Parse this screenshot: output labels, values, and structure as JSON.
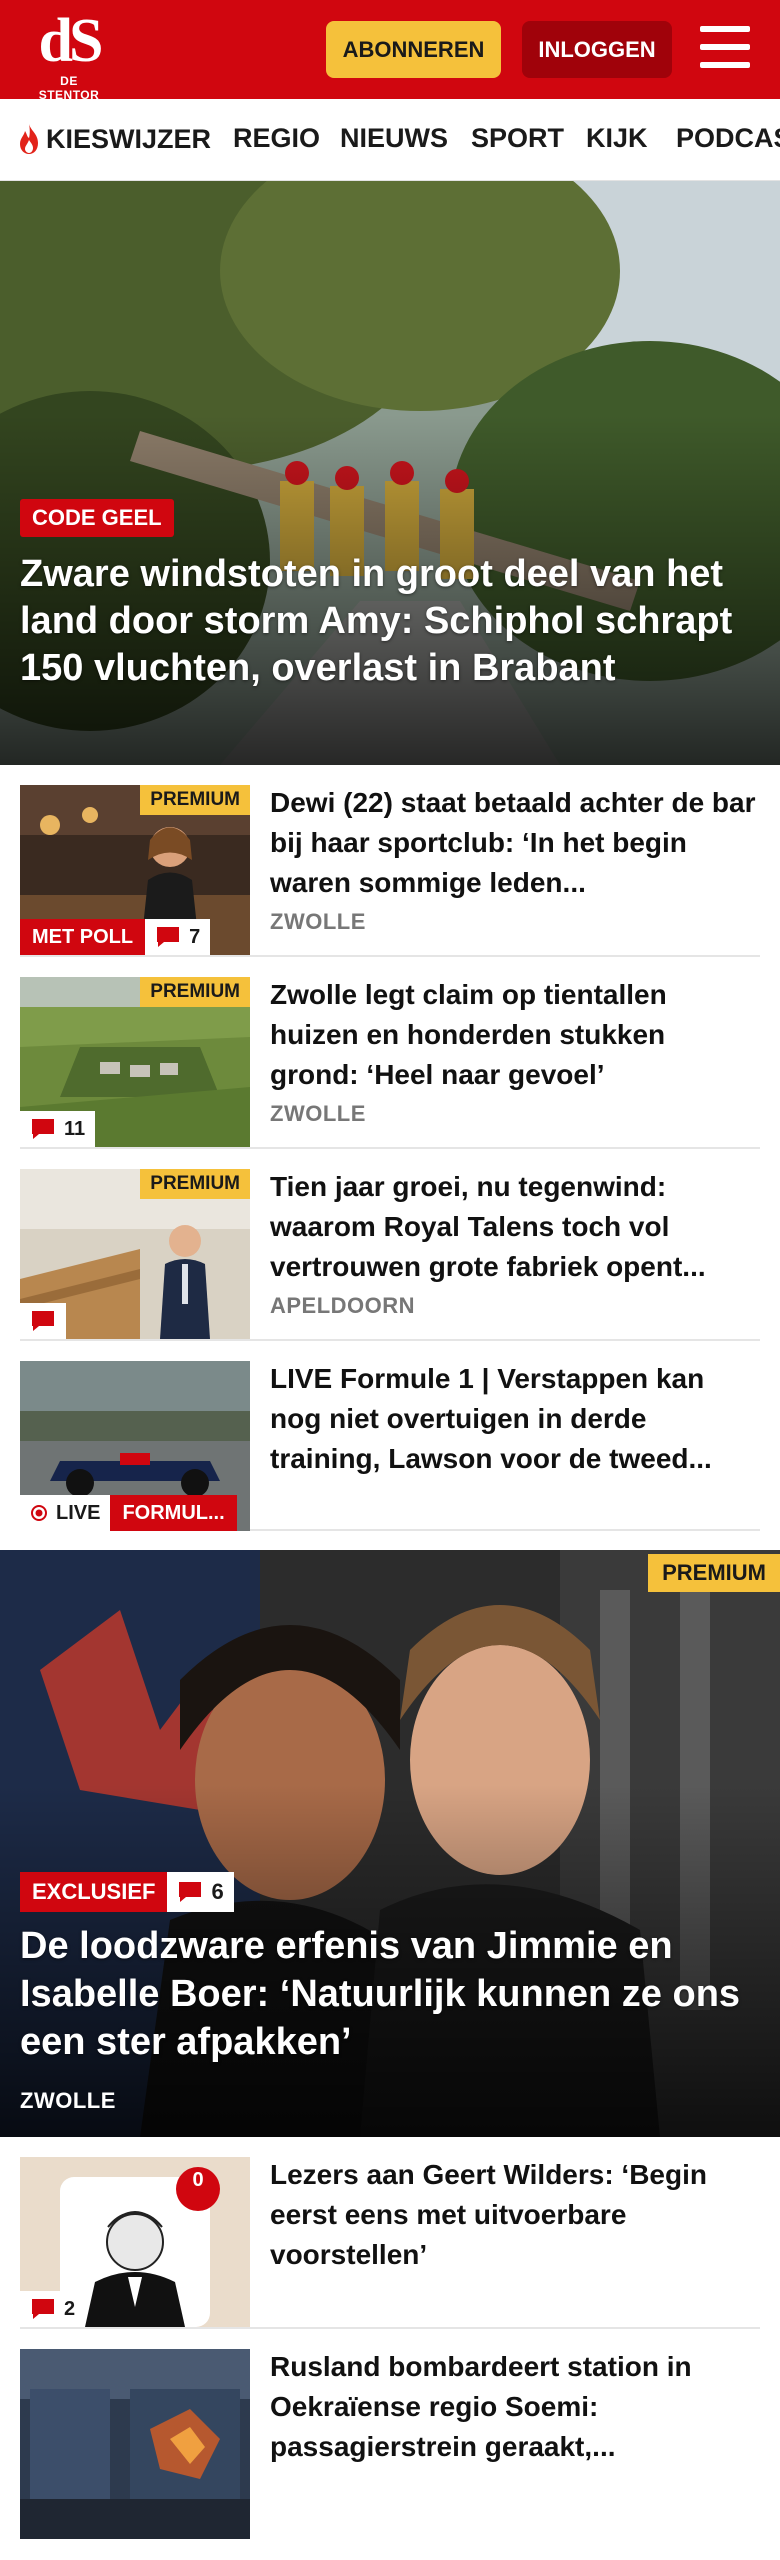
{
  "header": {
    "logo_mark": "dS",
    "logo_sub": "DE STENTOR",
    "subscribe_label": "ABONNEREN",
    "login_label": "INLOGGEN",
    "menu_icon": "hamburger-icon"
  },
  "nav": {
    "items": [
      {
        "label": "KIESWIJZER",
        "icon": "flame-icon"
      },
      {
        "label": "REGIO"
      },
      {
        "label": "NIEUWS"
      },
      {
        "label": "SPORT"
      },
      {
        "label": "KIJK"
      },
      {
        "label": "PODCAST"
      }
    ]
  },
  "hero": {
    "tag": "CODE GEEL",
    "title": "Zware windstoten in groot deel van het land door storm Amy: Schiphol schrapt 150 vluchten, overlast in Brabant"
  },
  "articles": [
    {
      "premium": "PREMIUM",
      "badge": "MET POLL",
      "comments": "7",
      "title": "Dewi (22) staat betaald achter de bar bij haar sportclub: ‘In het begin waren sommige leden...",
      "location": "ZWOLLE"
    },
    {
      "premium": "PREMIUM",
      "comments": "11",
      "title": "Zwolle legt claim op tientallen huizen en honderden stukken grond: ‘Heel naar gevoel’",
      "location": "ZWOLLE"
    },
    {
      "premium": "PREMIUM",
      "comments": "",
      "title": "Tien jaar groei, nu tegenwind: waarom Royal Talens toch vol vertrouwen grote fabriek opent...",
      "location": "APELDOORN"
    },
    {
      "live": "LIVE",
      "badge": "FORMUL...",
      "title": "LIVE Formule 1 | Verstappen kan nog niet overtuigen in derde training, Lawson voor de tweed...",
      "location": ""
    }
  ],
  "feature": {
    "premium": "PREMIUM",
    "tag": "EXCLUSIEF",
    "comments": "6",
    "title": "De loodzware erfenis van Jimmie en Isabelle Boer: ‘Natuurlijk kunnen ze ons een ster afpakken’",
    "location": "ZWOLLE"
  },
  "articles_2": [
    {
      "thumb_counter": "0",
      "comments": "2",
      "title": "Lezers aan Geert Wilders: ‘Begin eerst eens met uitvoerbare voorstellen’"
    },
    {
      "title": "Rusland bombardeert station in Oekraïense regio Soemi: passagierstrein geraakt,..."
    }
  ],
  "colors": {
    "brand_red": "#d0060f",
    "login_red": "#a0020a",
    "premium_yellow": "#f5c13b",
    "meta_gray": "#777777"
  }
}
